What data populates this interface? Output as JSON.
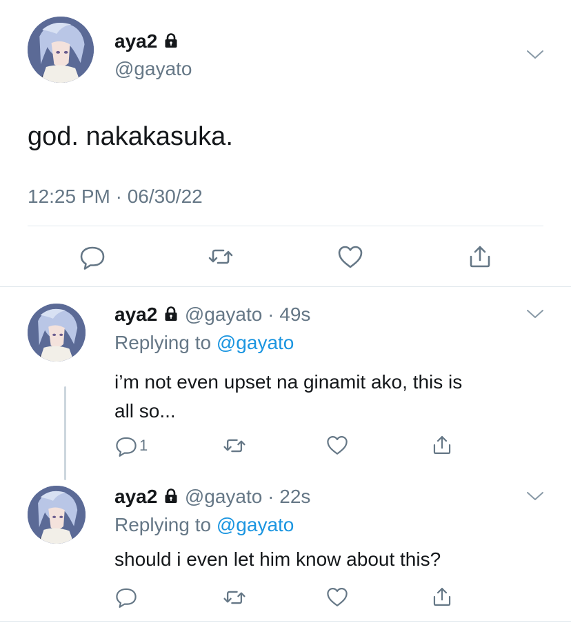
{
  "main_tweet": {
    "display_name": "aya2",
    "handle": "@gayato",
    "text": "god. nakakasuka.",
    "timestamp": "12:25 PM · 06/30/22",
    "protected": true
  },
  "replies": [
    {
      "display_name": "aya2",
      "handle": "@gayato",
      "age": "· 49s",
      "replying_to_label": "Replying to",
      "replying_to_handle": "@gayato",
      "text_line1": "i’m not even upset na ginamit ako, this is",
      "text_line2": "all so...",
      "reply_count": "1",
      "protected": true
    },
    {
      "display_name": "aya2",
      "handle": "@gayato",
      "age": "· 22s",
      "replying_to_label": "Replying to",
      "replying_to_handle": "@gayato",
      "text_line1": "should i even let him know about this?",
      "reply_count": "",
      "protected": true
    }
  ],
  "icons": {
    "reply": "speech-bubble",
    "retweet": "retweet-arrows",
    "like": "heart",
    "share": "share-up-arrow",
    "menu": "chevron-down",
    "protected": "lock"
  },
  "colors": {
    "text": "#14171a",
    "muted": "#657786",
    "link": "#1b95e0",
    "divider": "#e1e8ed",
    "background": "#ffffff"
  }
}
